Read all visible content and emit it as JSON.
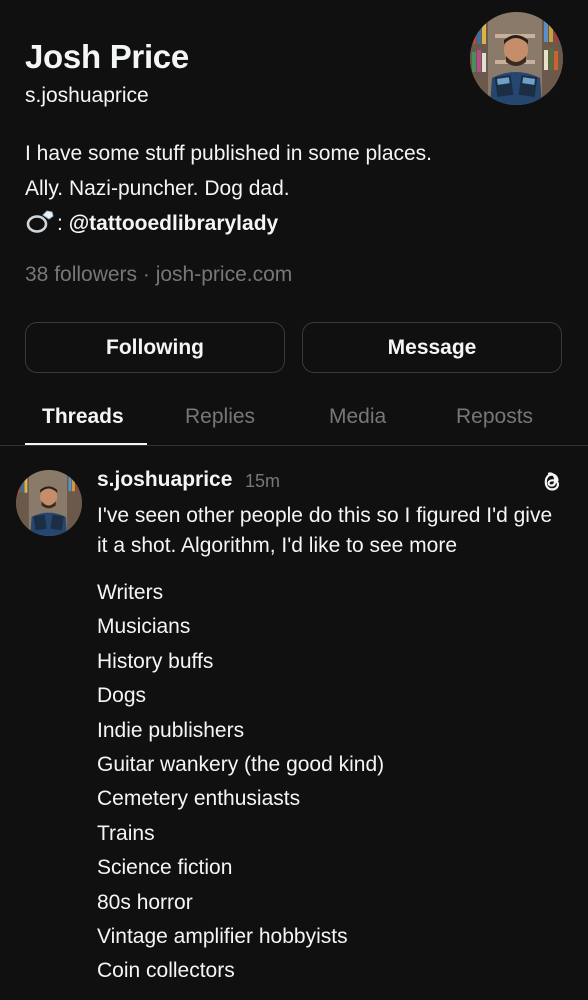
{
  "profile": {
    "display_name": "Josh Price",
    "username": "s.joshuaprice",
    "bio": {
      "line1": "I have some stuff published in some places.",
      "line2": "Ally. Nazi-puncher. Dog dad.",
      "line3_separator": ":",
      "line3_mention": "@tattooedlibrarylady",
      "line3_icon": "ring-icon"
    },
    "stats": "38 followers · josh-price.com"
  },
  "actions": {
    "following_label": "Following",
    "message_label": "Message"
  },
  "tabs": [
    {
      "label": "Threads",
      "active": true
    },
    {
      "label": "Replies",
      "active": false
    },
    {
      "label": "Media",
      "active": false
    },
    {
      "label": "Reposts",
      "active": false
    }
  ],
  "post": {
    "author": "s.joshuaprice",
    "time": "15m",
    "text": "I've seen other people do this so I figured I'd give it a shot. Algorithm, I'd like to see more",
    "items": [
      "Writers",
      "Musicians",
      "History buffs",
      "Dogs",
      "Indie publishers",
      "Guitar wankery (the good kind)",
      "Cemetery enthusiasts",
      "Trains",
      "Science fiction",
      "80s horror",
      "Vintage amplifier hobbyists",
      "Coin collectors"
    ],
    "platform_icon": "threads-icon"
  },
  "colors": {
    "background": "#101010",
    "text_primary": "#f3f5f7",
    "text_secondary": "#777777",
    "border": "#3a3a3a"
  }
}
